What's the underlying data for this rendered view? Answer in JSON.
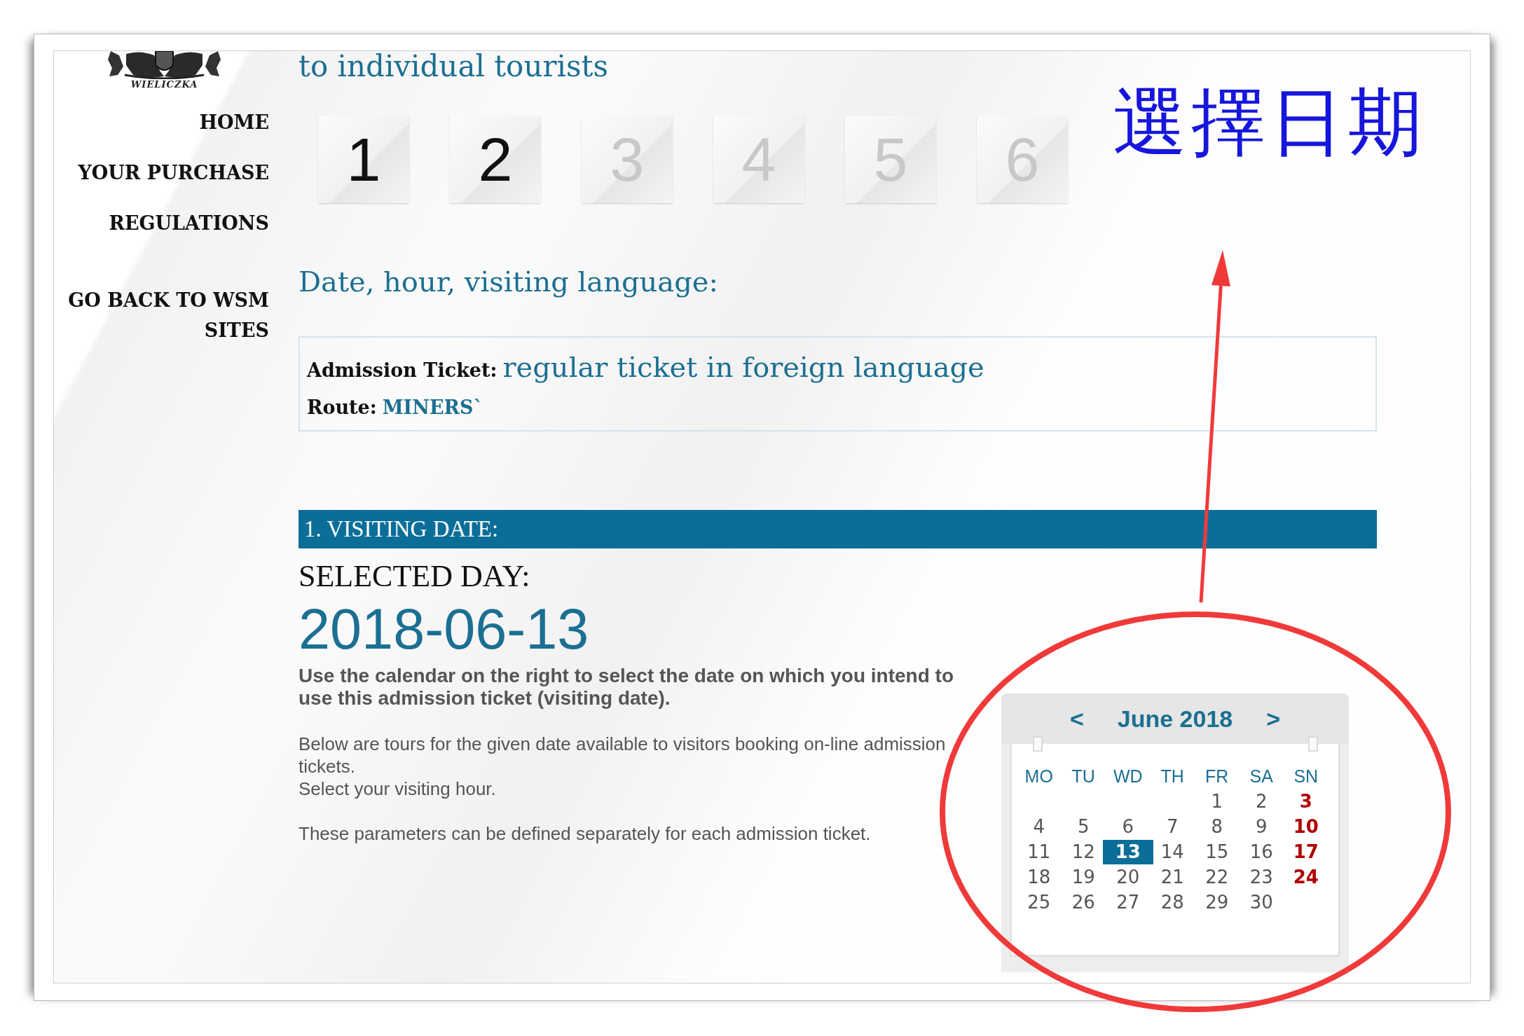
{
  "logo": {
    "text": "WIELICZKA"
  },
  "nav": {
    "items": [
      {
        "label": "HOME"
      },
      {
        "label": "YOUR PURCHASE"
      },
      {
        "label": "REGULATIONS"
      }
    ],
    "back_link": "GO BACK TO WSM SITES"
  },
  "heading": "to individual tourists",
  "steps": [
    {
      "label": "1",
      "reached": true
    },
    {
      "label": "2",
      "reached": true
    },
    {
      "label": "3",
      "reached": false
    },
    {
      "label": "4",
      "reached": false
    },
    {
      "label": "5",
      "reached": false
    },
    {
      "label": "6",
      "reached": false
    }
  ],
  "section_title": "Date, hour, visiting language:",
  "ticket": {
    "label": "Admission Ticket:",
    "value": "regular ticket in foreign language",
    "route_label": "Route:",
    "route": "MINERS`"
  },
  "visiting_date": {
    "bar_title": "1. VISITING DATE:",
    "selected_label": "SELECTED DAY:",
    "selected_date": "2018-06-13",
    "instructions": "Use the calendar on the right to select the date on which you intend to use this admission ticket (visiting date).",
    "notes": [
      [
        "Below are tours for the given date available to visitors booking on-line admission tickets.",
        "Select your visiting hour."
      ],
      [
        "These parameters can be defined separately for each admission ticket."
      ]
    ]
  },
  "calendar": {
    "prev": "<",
    "month": "June 2018",
    "next": ">",
    "weekdays": [
      "MO",
      "TU",
      "WD",
      "TH",
      "FR",
      "SA",
      "SN"
    ],
    "weeks": [
      {
        "days": [
          {
            "day": "1",
            "holiday": false,
            "selected": false
          },
          {
            "day": "2",
            "holiday": false,
            "selected": false
          },
          {
            "day": "3",
            "holiday": true,
            "selected": false
          }
        ]
      },
      {
        "days": [
          {
            "day": "4",
            "holiday": false,
            "selected": false
          },
          {
            "day": "5",
            "holiday": false,
            "selected": false
          },
          {
            "day": "6",
            "holiday": false,
            "selected": false
          },
          {
            "day": "7",
            "holiday": false,
            "selected": false
          },
          {
            "day": "8",
            "holiday": false,
            "selected": false
          },
          {
            "day": "9",
            "holiday": false,
            "selected": false
          },
          {
            "day": "10",
            "holiday": true,
            "selected": false
          }
        ]
      },
      {
        "days": [
          {
            "day": "11",
            "holiday": false,
            "selected": false
          },
          {
            "day": "12",
            "holiday": false,
            "selected": false
          },
          {
            "day": "13",
            "holiday": false,
            "selected": true
          },
          {
            "day": "14",
            "holiday": false,
            "selected": false
          },
          {
            "day": "15",
            "holiday": false,
            "selected": false
          },
          {
            "day": "16",
            "holiday": false,
            "selected": false
          },
          {
            "day": "17",
            "holiday": true,
            "selected": false
          }
        ]
      },
      {
        "days": [
          {
            "day": "18",
            "holiday": false,
            "selected": false
          },
          {
            "day": "19",
            "holiday": false,
            "selected": false
          },
          {
            "day": "20",
            "holiday": false,
            "selected": false
          },
          {
            "day": "21",
            "holiday": false,
            "selected": false
          },
          {
            "day": "22",
            "holiday": false,
            "selected": false
          },
          {
            "day": "23",
            "holiday": false,
            "selected": false
          },
          {
            "day": "24",
            "holiday": true,
            "selected": false
          }
        ]
      },
      {
        "days": [
          {
            "day": "25",
            "holiday": false,
            "selected": false
          },
          {
            "day": "26",
            "holiday": false,
            "selected": false
          },
          {
            "day": "27",
            "holiday": false,
            "selected": false
          },
          {
            "day": "28",
            "holiday": false,
            "selected": false
          },
          {
            "day": "29",
            "holiday": false,
            "selected": false
          },
          {
            "day": "30",
            "holiday": false,
            "selected": false
          }
        ]
      }
    ]
  },
  "annotation": {
    "note": "選擇日期"
  }
}
